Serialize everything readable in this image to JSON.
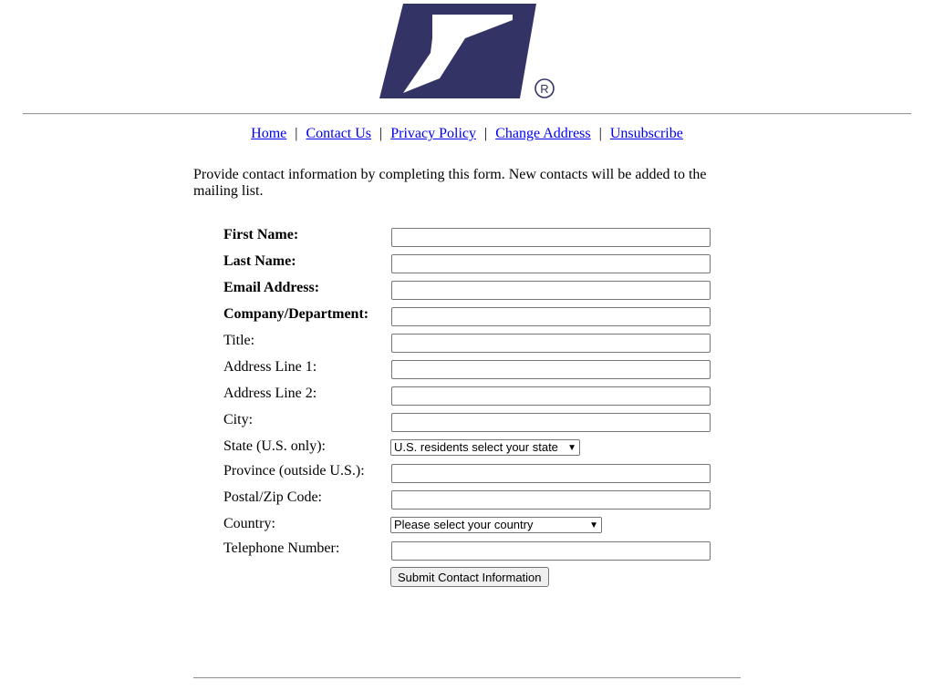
{
  "logo": {
    "name": "usps-eagle-logo",
    "registered_mark": "R",
    "brand_color": "#333366"
  },
  "nav": {
    "items": [
      "Home",
      "Contact Us",
      "Privacy Policy",
      "Change Address",
      "Unsubscribe"
    ],
    "separator": "|"
  },
  "intro": "Provide contact information by completing this form. New contacts will be added to the mailing list.",
  "form": {
    "first_name_label": "First Name:",
    "last_name_label": "Last Name:",
    "email_label": "Email Address:",
    "company_label": "Company/Department:",
    "title_label": "Title:",
    "address1_label": "Address Line 1:",
    "address2_label": "Address Line 2:",
    "city_label": "City:",
    "state_label": "State (U.S. only):",
    "state_selected": "U.S. residents select your state",
    "province_label": "Province (outside U.S.):",
    "postal_label": "Postal/Zip Code:",
    "country_label": "Country:",
    "country_selected": "Please select your country",
    "phone_label": "Telephone Number:",
    "submit_label": "Submit Contact Information"
  }
}
